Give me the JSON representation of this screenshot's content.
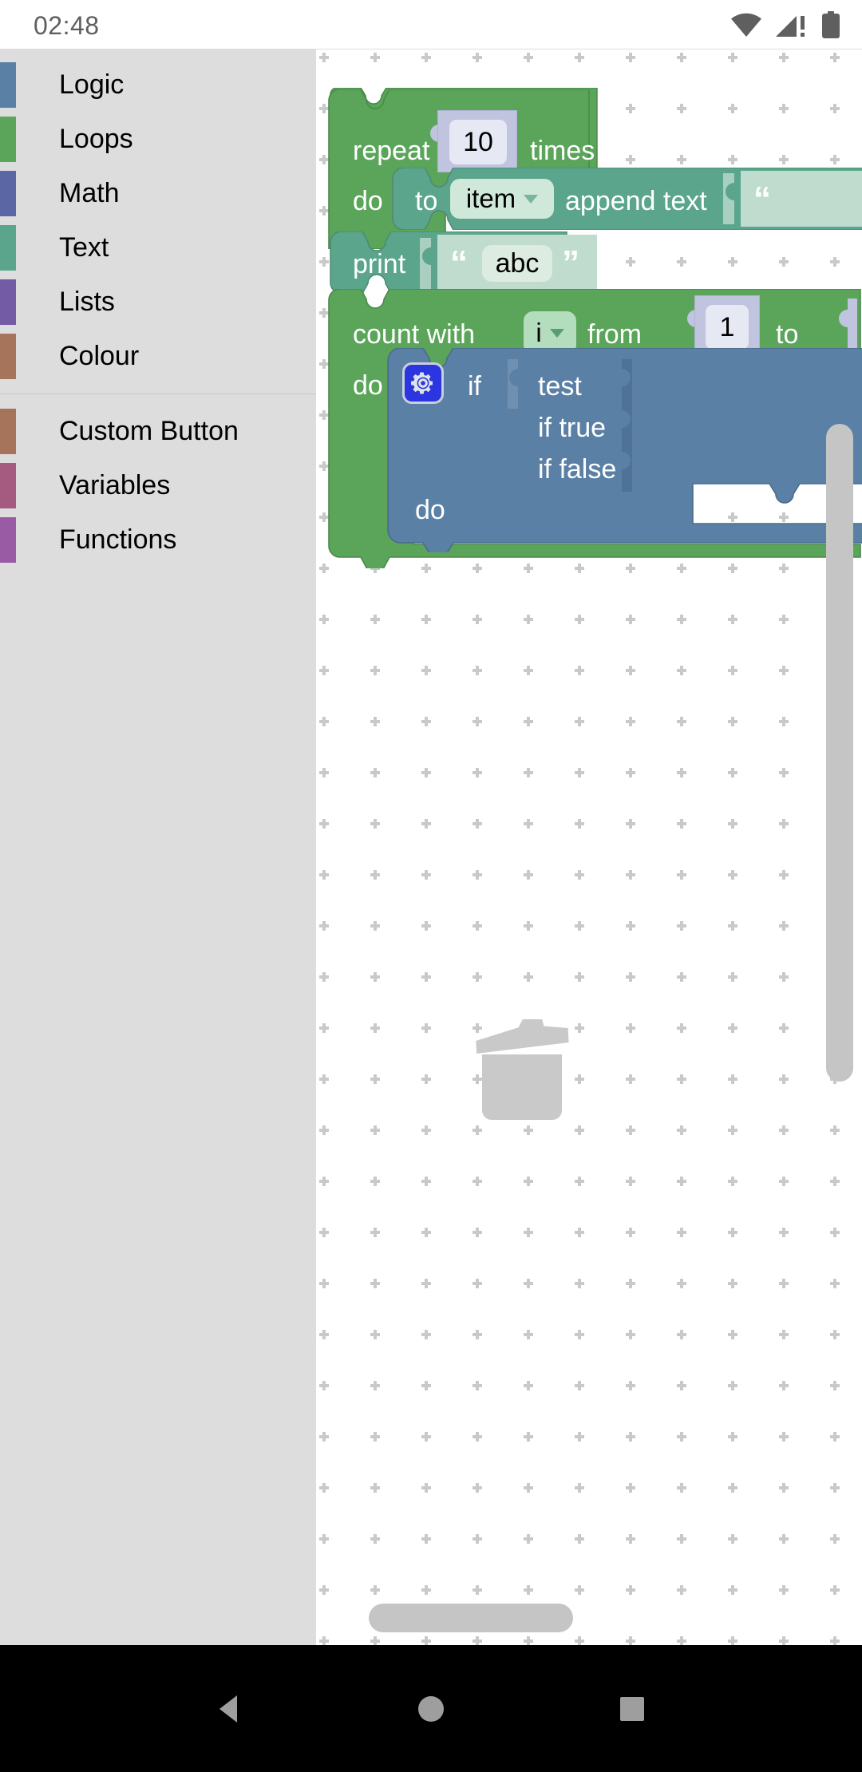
{
  "status_bar": {
    "time": "02:48",
    "icons": [
      "wifi-icon",
      "cellular-signal-warning-icon",
      "battery-full-icon"
    ]
  },
  "toolbox": {
    "groups": [
      {
        "items": [
          {
            "label": "Logic",
            "color": "#5b80a5"
          },
          {
            "label": "Loops",
            "color": "#5ba55b"
          },
          {
            "label": "Math",
            "color": "#5b67a5"
          },
          {
            "label": "Text",
            "color": "#5ba58c"
          },
          {
            "label": "Lists",
            "color": "#745ba5"
          },
          {
            "label": "Colour",
            "color": "#a5745b"
          }
        ]
      },
      {
        "items": [
          {
            "label": "Custom Button",
            "color": "#a5745b"
          },
          {
            "label": "Variables",
            "color": "#a55b80"
          },
          {
            "label": "Functions",
            "color": "#9a5ba5"
          }
        ]
      }
    ]
  },
  "workspace": {
    "colors": {
      "loops": "#5ba55b",
      "loops_dark": "#4a8a4a",
      "text": "#5ba58c",
      "text_light": "#bfdccf",
      "text_mid": "#a8cfc0",
      "logic": "#5b80a5",
      "math_field": "#c0c4de",
      "gear": "#2b35e0",
      "grid_dot": "#c9c9c9",
      "scrollbar": "#c5c5c5",
      "trash": "#c9c9c9"
    },
    "blocks": [
      {
        "id": "repeat-block",
        "type": "controls_repeat_ext",
        "kind": "loops",
        "labels": [
          "repeat",
          "times",
          "do"
        ],
        "value": "10"
      },
      {
        "id": "text-append-block",
        "type": "text_append",
        "kind": "text",
        "labels": [
          "to",
          "append text"
        ],
        "variable": "item"
      },
      {
        "id": "print-block",
        "type": "text_print",
        "kind": "text",
        "labels": [
          "print"
        ]
      },
      {
        "id": "text-string-block",
        "type": "text",
        "kind": "text",
        "open_quote": "“",
        "close_quote": "”",
        "value": "abc"
      },
      {
        "id": "count-with-block",
        "type": "controls_for",
        "kind": "loops",
        "labels": [
          "count with",
          "from",
          "to",
          "do"
        ],
        "variable": "i",
        "from_value": "1"
      },
      {
        "id": "if-block",
        "type": "controls_if",
        "kind": "logic",
        "gear_icon": "gear-icon",
        "labels": [
          "if",
          "test",
          "if true",
          "if false",
          "do"
        ]
      }
    ],
    "trash_icon": "trash-can-icon",
    "scrollbars": [
      "vertical-scrollbar",
      "horizontal-scrollbar"
    ]
  },
  "nav_bar": {
    "buttons": [
      {
        "name": "back-button",
        "icon": "triangle-left-icon"
      },
      {
        "name": "home-button",
        "icon": "circle-icon"
      },
      {
        "name": "recents-button",
        "icon": "square-icon"
      }
    ]
  }
}
